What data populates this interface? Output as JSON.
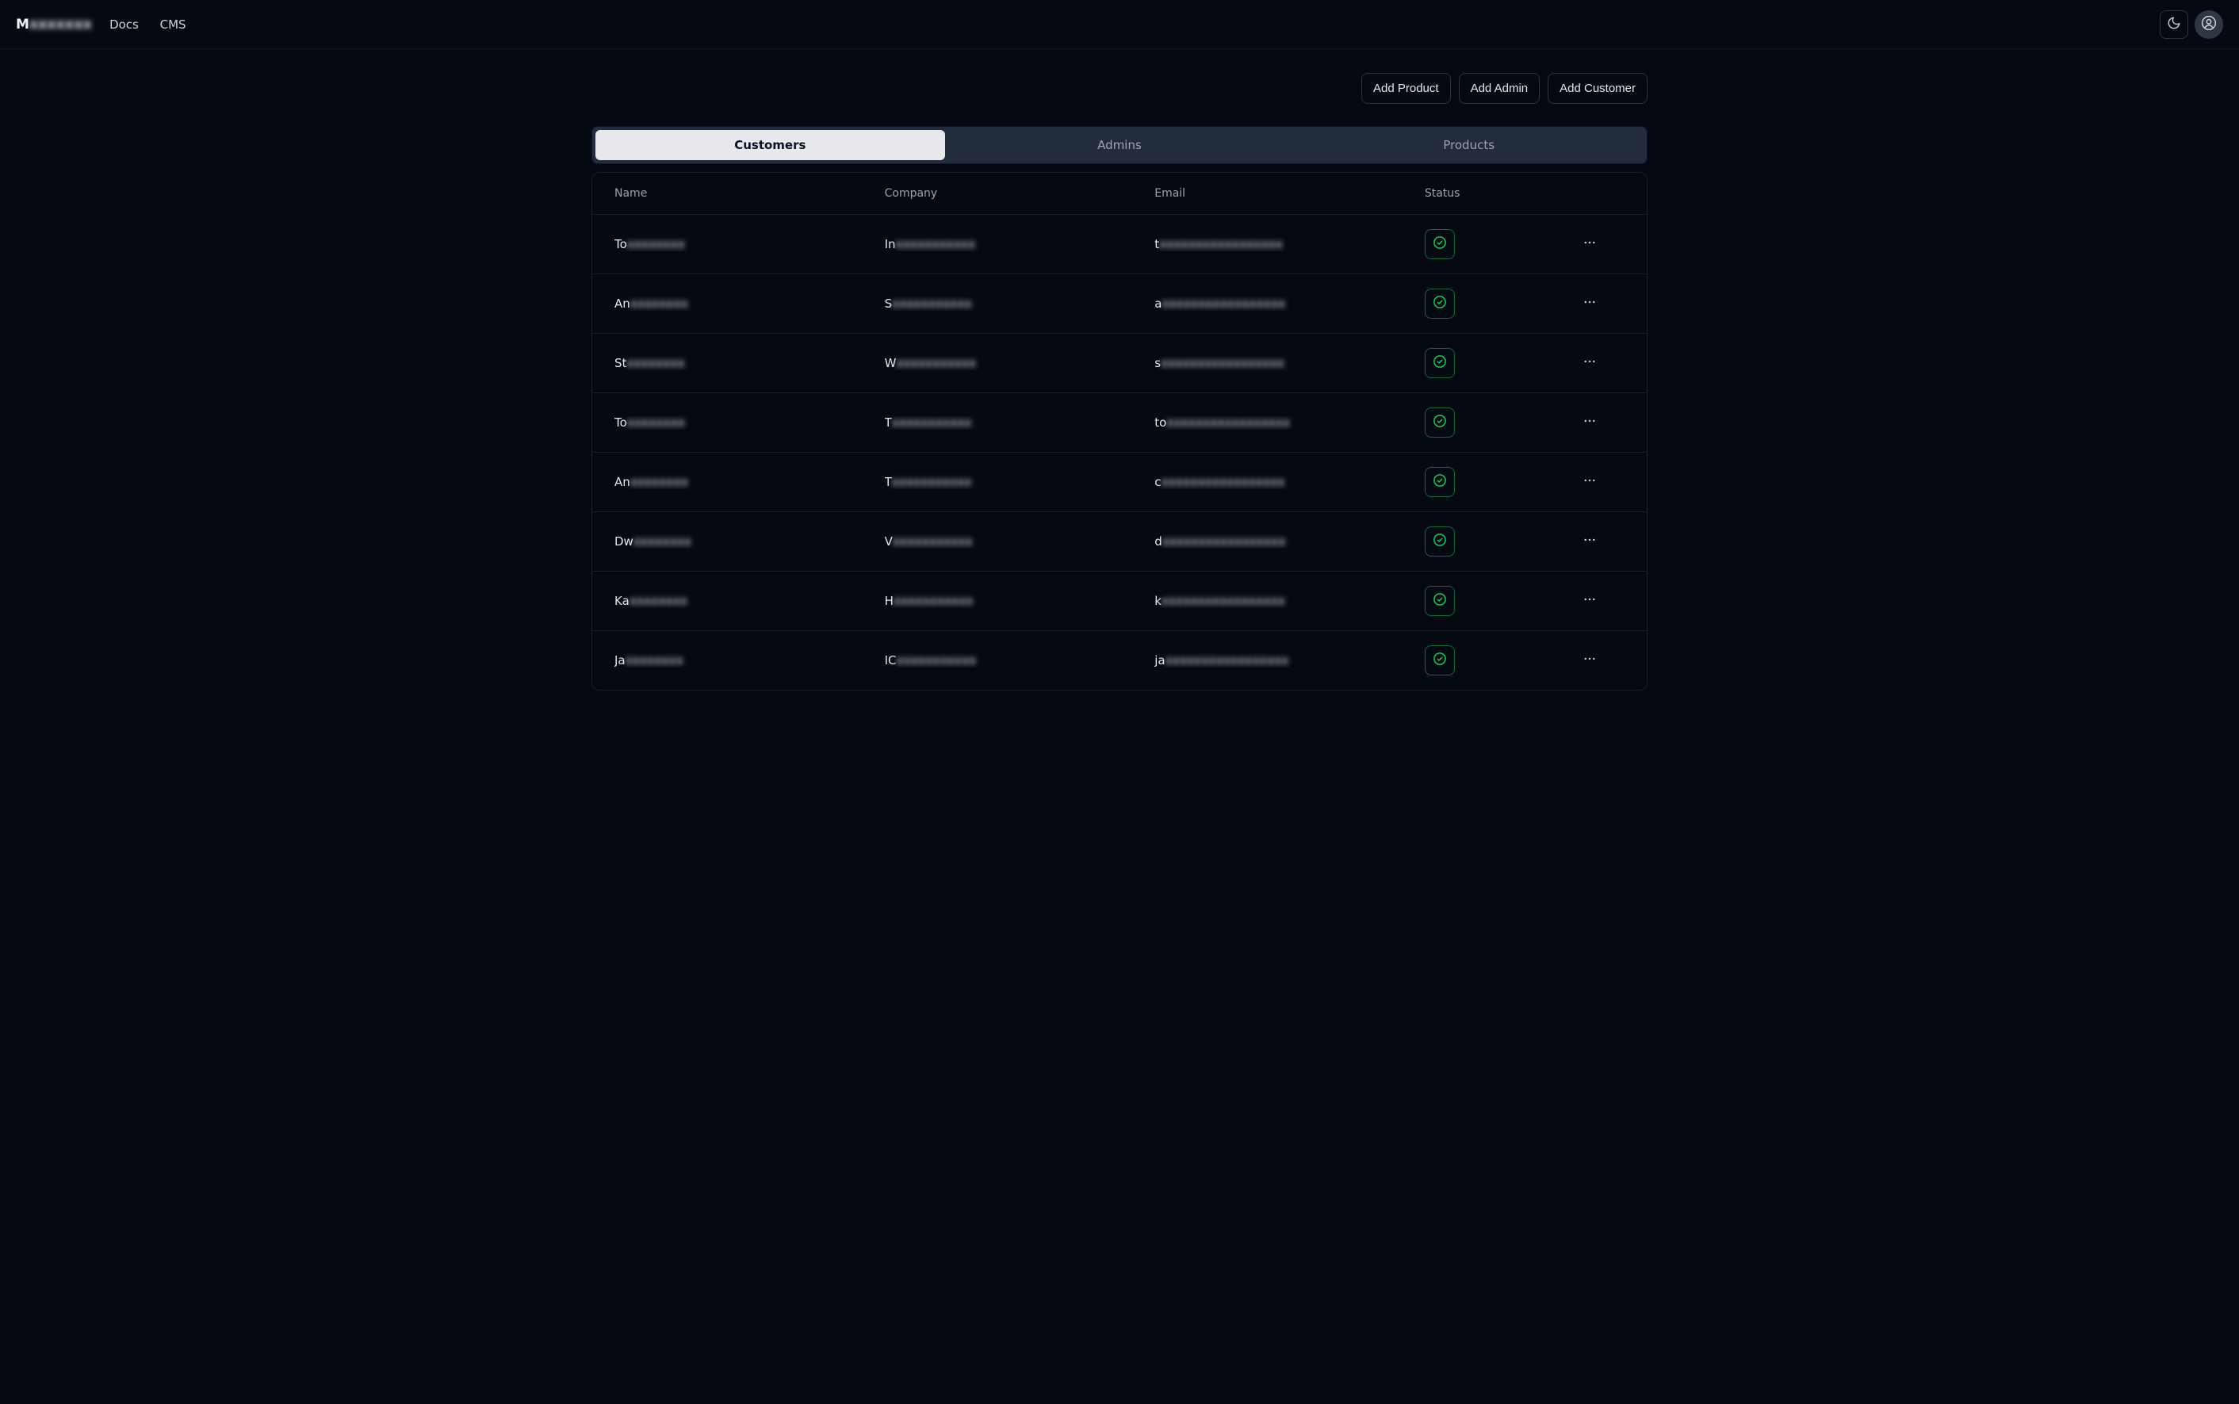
{
  "header": {
    "brand": "M",
    "nav": {
      "docs": "Docs",
      "cms": "CMS"
    }
  },
  "actions": {
    "add_product": "Add Product",
    "add_admin": "Add Admin",
    "add_customer": "Add Customer"
  },
  "tabs": {
    "customers": "Customers",
    "admins": "Admins",
    "products": "Products",
    "active": "customers"
  },
  "table": {
    "headers": {
      "name": "Name",
      "company": "Company",
      "email": "Email",
      "status": "Status"
    },
    "rows": [
      {
        "name_prefix": "To",
        "company_prefix": "In",
        "email_prefix": "t",
        "status": "active"
      },
      {
        "name_prefix": "An",
        "company_prefix": "S",
        "email_prefix": "a",
        "status": "active"
      },
      {
        "name_prefix": "St",
        "company_prefix": "W",
        "email_prefix": "s",
        "status": "active"
      },
      {
        "name_prefix": "To",
        "company_prefix": "T",
        "email_prefix": "to",
        "status": "active"
      },
      {
        "name_prefix": "An",
        "company_prefix": "T",
        "email_prefix": "c",
        "status": "active"
      },
      {
        "name_prefix": "Dw",
        "company_prefix": "V",
        "email_prefix": "d",
        "status": "active"
      },
      {
        "name_prefix": "Ka",
        "company_prefix": "H",
        "email_prefix": "k",
        "status": "active"
      },
      {
        "name_prefix": "Ja",
        "company_prefix": "IC",
        "email_prefix": "ja",
        "status": "active"
      }
    ]
  }
}
